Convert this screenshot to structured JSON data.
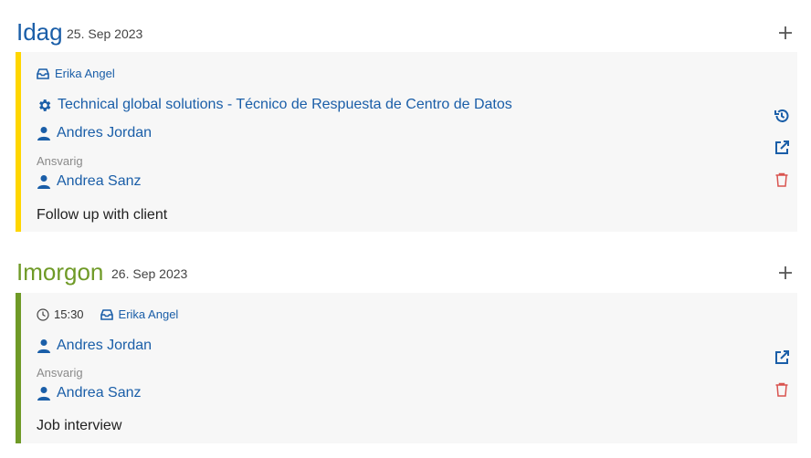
{
  "sections": [
    {
      "title": "Idag",
      "date": "25. Sep 2023",
      "accent": "#ffd600",
      "card": {
        "owner": "Erika Angel",
        "company": "Technical global solutions - Técnico de Respuesta de Centro de Datos",
        "contact": "Andres Jordan",
        "responsible_label": "Ansvarig",
        "responsible": "Andrea Sanz",
        "note": "Follow up with client"
      }
    },
    {
      "title": "Imorgon",
      "date": "26. Sep 2023",
      "accent": "#6f9a27",
      "card": {
        "time": "15:30",
        "owner": "Erika Angel",
        "contact": "Andres Jordan",
        "responsible_label": "Ansvarig",
        "responsible": "Andrea Sanz",
        "note": "Job interview"
      }
    }
  ],
  "colors": {
    "link": "#1a5ea8",
    "today_title": "#1a5ea8",
    "tomorrow_title": "#6f9a27",
    "delete": "#d9534f",
    "card_bg": "#f7f7f7"
  },
  "icons": {
    "add": "plus-icon",
    "owner": "inbox-icon",
    "company": "gear-icon",
    "person": "user-icon",
    "history": "history-icon",
    "open": "external-link-icon",
    "delete": "trash-icon",
    "time": "clock-icon"
  }
}
